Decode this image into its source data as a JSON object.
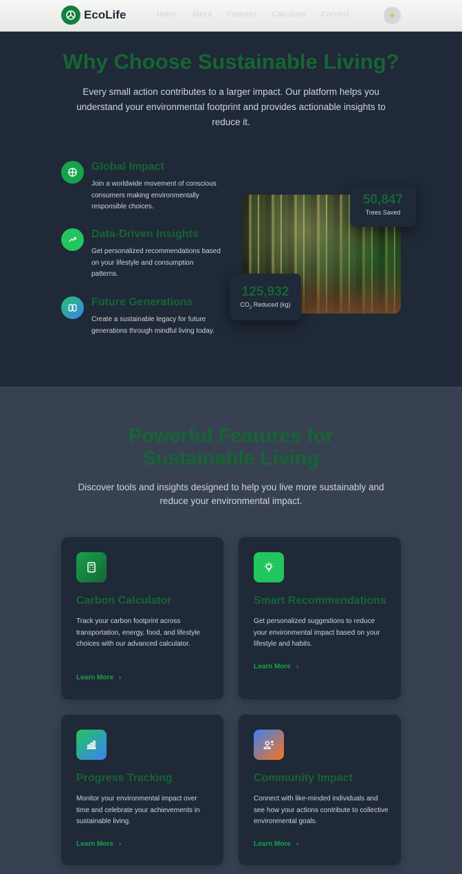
{
  "header": {
    "brand": "EcoLife",
    "nav": [
      "Home",
      "About",
      "Features",
      "Calculator",
      "Connect"
    ]
  },
  "why": {
    "title": "Why Choose Sustainable Living?",
    "text": "Every small action contributes to a larger impact. Our platform helps you understand your environmental footprint and provides actionable insights to reduce it.",
    "benefits": [
      {
        "title": "Global Impact",
        "desc": "Join a worldwide movement of conscious consumers making environmentally responsible choices.",
        "icon": "globe-icon"
      },
      {
        "title": "Data-Driven Insights",
        "desc": "Get personalized recommendations based on your lifestyle and consumption patterns.",
        "icon": "trend-up-icon"
      },
      {
        "title": "Future Generations",
        "desc": "Create a sustainable legacy for future generations through mindful living today.",
        "icon": "pages-icon"
      }
    ],
    "stats": [
      {
        "value": "50,847",
        "label": "Trees Saved"
      },
      {
        "value": "125,932",
        "label_pre": "CO",
        "label_sub": "2",
        "label_post": " Reduced (kg)"
      }
    ]
  },
  "features": {
    "title_line1": "Powerful Features for",
    "title_line2": "Sustainable Living",
    "text": "Discover tools and insights designed to help you live more sustainably and reduce your environmental impact.",
    "cards": [
      {
        "title": "Carbon Calculator",
        "desc": "Track your carbon footprint across transportation, energy, food, and lifestyle choices with our advanced calculator.",
        "link": "Learn More",
        "icon": "calculator-icon"
      },
      {
        "title": "Smart Recommendations",
        "desc": "Get personalized suggestions to reduce your environmental impact based on your lifestyle and habits.",
        "link": "Learn More",
        "icon": "lightbulb-icon"
      },
      {
        "title": "Progress Tracking",
        "desc": "Monitor your environmental impact over time and celebrate your achievements in sustainable living.",
        "link": "Learn More",
        "icon": "bar-chart-icon"
      },
      {
        "title": "Community Impact",
        "desc": "Connect with like-minded individuals and see how your actions contribute to collective environmental goals.",
        "link": "Learn More",
        "icon": "community-icon"
      }
    ]
  },
  "colors": {
    "accent": "#16a34a",
    "heading_green": "#166534",
    "dark_bg": "#1f2937",
    "section_bg": "#374151"
  }
}
